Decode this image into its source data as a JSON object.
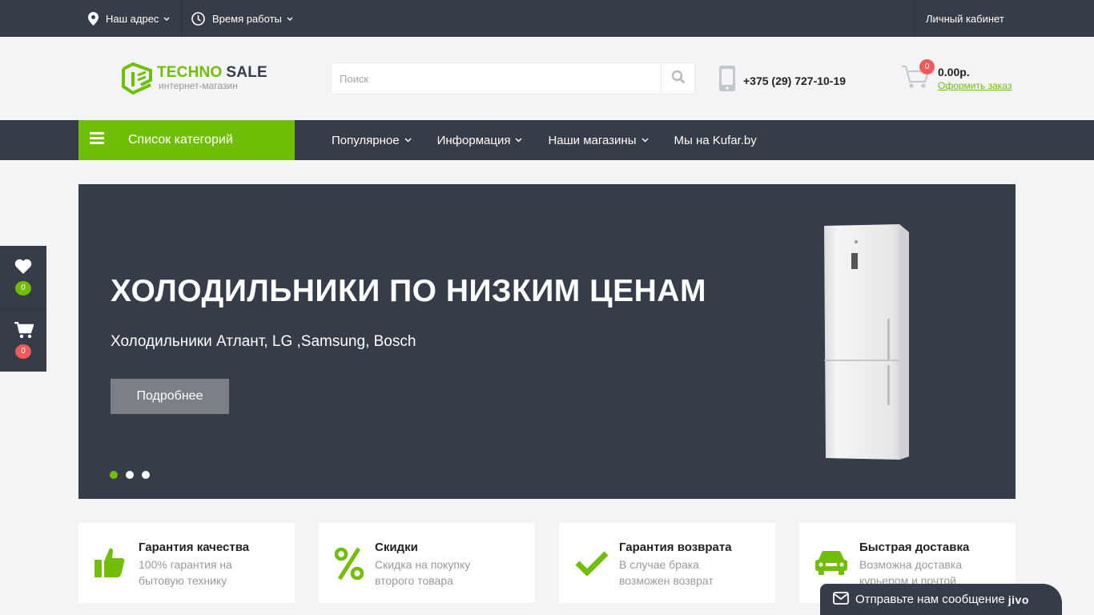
{
  "topbar": {
    "address": "Наш адрес",
    "hours": "Время работы",
    "cabinet": "Личный кабинет"
  },
  "header": {
    "logo_word1": "TECHNO",
    "logo_word2": "SALE",
    "logo_sub": "интернет-магазин",
    "search_placeholder": "Поиск",
    "phone": "+375 (29) 727-10-19",
    "cart_count": "0",
    "cart_total": "0.00р.",
    "order_link": "Оформить заказ"
  },
  "nav": {
    "categories": "Список категорий",
    "items": [
      {
        "label": "Популярное"
      },
      {
        "label": "Информация"
      },
      {
        "label": "Наши магазины"
      },
      {
        "label": "Мы на Kufar.by"
      }
    ]
  },
  "slider": {
    "title": "ХОЛОДИЛЬНИКИ ПО НИЗКИМ ЦЕНАМ",
    "subtitle": "Холодильники Атлант, LG ,Samsung, Bosch",
    "button": "Подробнее",
    "slides": 3,
    "active_slide": 1
  },
  "side_widget": {
    "wishlist_count": "0",
    "cart_count": "0"
  },
  "features": [
    {
      "icon": "thumbs-up-icon",
      "title": "Гарантия качества",
      "desc": "100% гарантия на бытовую технику"
    },
    {
      "icon": "percent-icon",
      "title": "Скидки",
      "desc": "Скидка на покупку второго товара"
    },
    {
      "icon": "checkmark-icon",
      "title": "Гарантия возврата",
      "desc": "В случае брака возможен возврат"
    },
    {
      "icon": "truck-icon",
      "title": "Быстрая доставка",
      "desc": "Возможна доставка курьером и почтой"
    }
  ],
  "chat": {
    "label": "Отправьте нам сообщение",
    "brand": "jivo"
  },
  "colors": {
    "accent": "#71be08",
    "dark": "#363c48",
    "badge": "#f15a5a",
    "background": "#f2f4f6"
  }
}
